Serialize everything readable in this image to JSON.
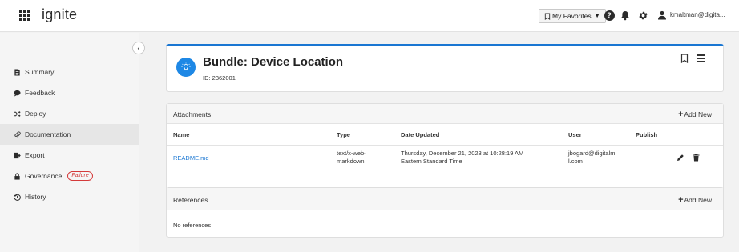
{
  "app": {
    "name": "ignite"
  },
  "topbar": {
    "favorites_label": "My Favorites",
    "user_email": "kmaltman@digita..."
  },
  "sidebar": {
    "items": [
      {
        "label": "Summary",
        "icon": "document-icon",
        "active": false
      },
      {
        "label": "Feedback",
        "icon": "chat-icon",
        "active": false
      },
      {
        "label": "Deploy",
        "icon": "shuffle-icon",
        "active": false
      },
      {
        "label": "Documentation",
        "icon": "paperclip-icon",
        "active": true
      },
      {
        "label": "Export",
        "icon": "export-icon",
        "active": false
      },
      {
        "label": "Governance",
        "icon": "lock-icon",
        "active": false,
        "badge": "Failure"
      },
      {
        "label": "History",
        "icon": "history-icon",
        "active": false
      }
    ]
  },
  "bundle": {
    "title": "Bundle: Device Location",
    "id_label": "ID: 2362001",
    "accent_color": "#1976d2"
  },
  "attachments": {
    "title": "Attachments",
    "add_label": "Add New",
    "columns": [
      "Name",
      "Type",
      "Date Updated",
      "User",
      "Publish"
    ],
    "rows": [
      {
        "name": "README.md",
        "type_line1": "text/x-web-",
        "type_line2": "markdown",
        "date_line1": "Thursday, December 21, 2023 at 10:28:19 AM",
        "date_line2": "Eastern Standard Time",
        "user_line1": "jbogard@digitalm",
        "user_line2": "l.com"
      }
    ]
  },
  "references": {
    "title": "References",
    "add_label": "Add New",
    "empty_text": "No references"
  }
}
